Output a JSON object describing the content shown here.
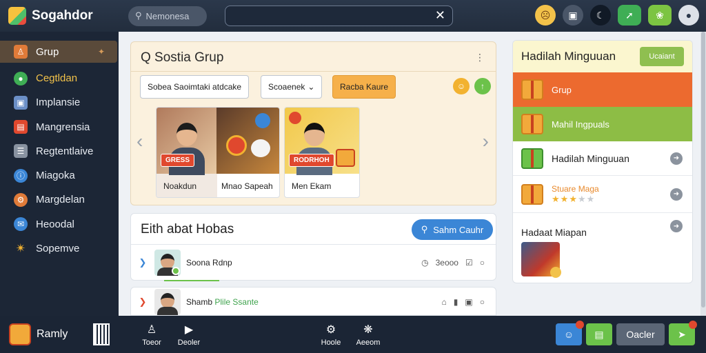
{
  "app": {
    "title": "Sogahdor",
    "search_pill": "Nemonesa"
  },
  "sidebar": {
    "items": [
      {
        "label": "Grup",
        "color": "#e07b39"
      },
      {
        "label": "Cegtldan",
        "color": "#3fae55"
      },
      {
        "label": "Implansie",
        "color": "#6b8fc7"
      },
      {
        "label": "Mangrensia",
        "color": "#e0482e"
      },
      {
        "label": "Regtentlaive",
        "color": "#8892a0"
      },
      {
        "label": "Miagoka",
        "color": "#3b86d6"
      },
      {
        "label": "Margdelan",
        "color": "#e07b39"
      },
      {
        "label": "Heoodal",
        "color": "#3b86d6"
      },
      {
        "label": "Sopemve",
        "color": "#f2b230"
      }
    ]
  },
  "group": {
    "title": "Q Sostia Grup",
    "chips": [
      "Sobea Saoimtaki atdcake",
      "Scoaenek",
      "Racba Kaure"
    ],
    "cards": [
      {
        "caption": "Noakdun",
        "tag": "GRESS"
      },
      {
        "caption": "Mnao Sapeah",
        "tag": ""
      },
      {
        "caption": "Men Ekam",
        "tag": "RODRHOH"
      }
    ]
  },
  "fresh": {
    "title": "Eith abat Hobas",
    "button": "Sahm Cauhr",
    "rows": [
      {
        "name": "Soona Rdnp",
        "highlight": "",
        "meta": "3eooo"
      },
      {
        "name": "Shamb",
        "highlight": "Plile Ssante",
        "meta": ""
      }
    ]
  },
  "weekly": {
    "title": "Hadilah Minguuan",
    "button": "Ucaiant",
    "band1": "Grup",
    "band2": "Mahil Ingpuals",
    "items": [
      {
        "label": "Hadilah Minguuan"
      },
      {
        "label": "Stuare Maga",
        "rating": 3,
        "rating_max": 5
      },
      {
        "label": "Hadaat Miapan"
      }
    ],
    "colors": {
      "band1": "#ec6a2f",
      "band2": "#8dbd45"
    }
  },
  "bottom": {
    "name": "Ramly",
    "tabs": [
      "Toeor",
      "Deoler",
      "Hoole",
      "Aeeom"
    ],
    "button": "Oacler"
  }
}
